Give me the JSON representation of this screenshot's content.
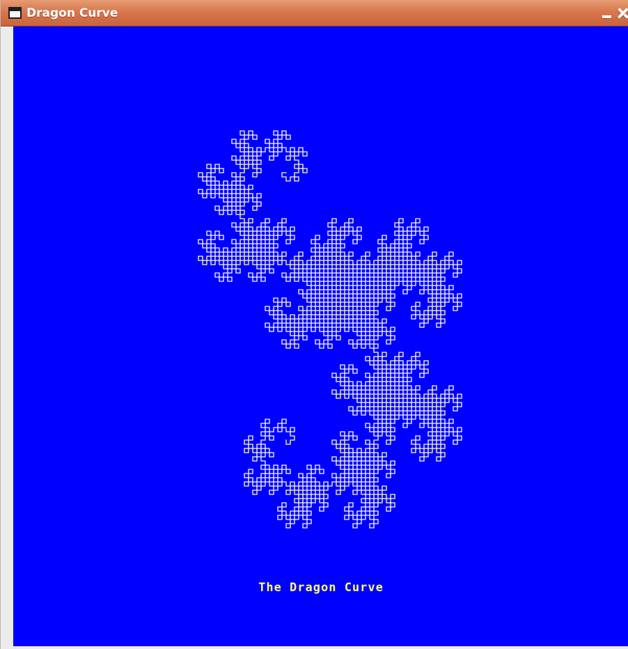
{
  "window": {
    "title": "Dragon Curve",
    "icons": {
      "app": "window-icon",
      "minimize": "minimize-icon",
      "close": "close-icon"
    }
  },
  "canvas": {
    "background_color": "#0000ff",
    "curve_color": "#ffffff",
    "caption_color": "#ffff6a",
    "caption": "The Dragon Curve"
  }
}
